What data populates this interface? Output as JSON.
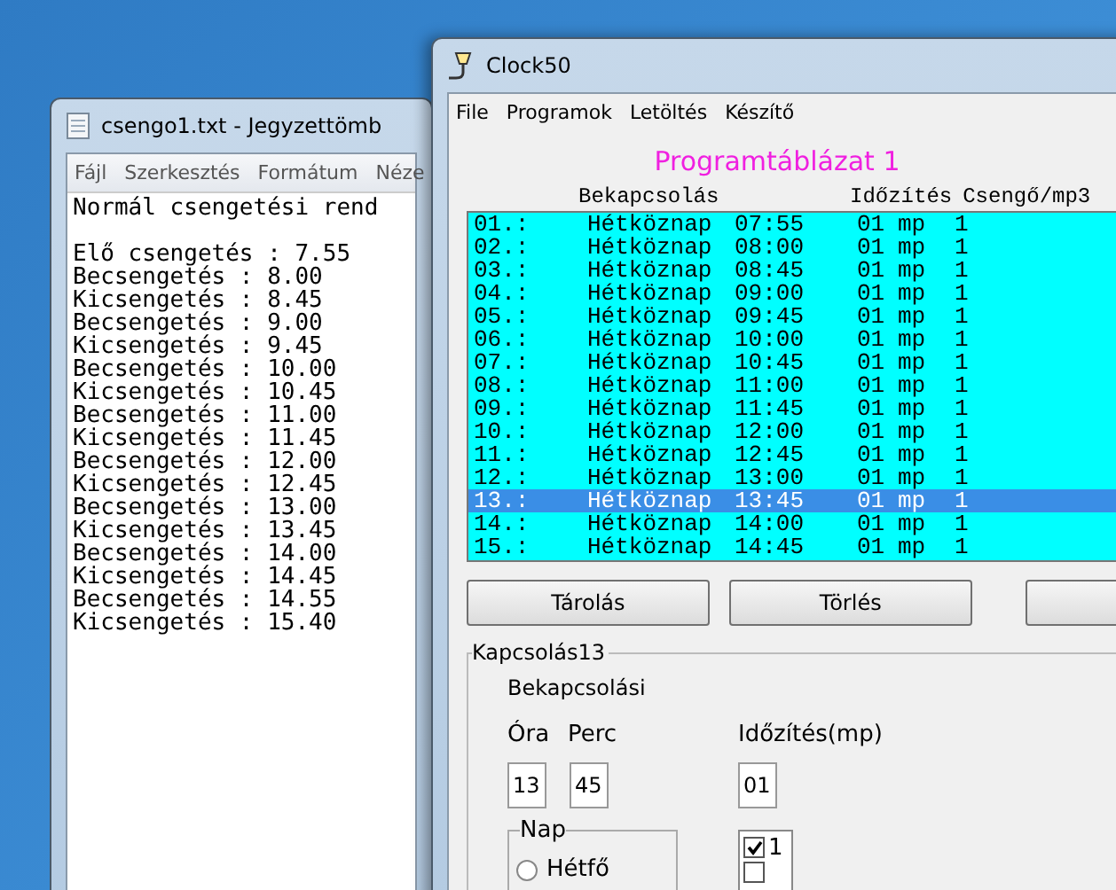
{
  "notepad": {
    "title": "csengo1.txt - Jegyzettömb",
    "menu": [
      "Fájl",
      "Szerkesztés",
      "Formátum",
      "Néze"
    ],
    "heading_line": "Normál csengetési rend",
    "lines": [
      "Elő csengetés : 7.55",
      "Becsengetés : 8.00",
      "Kicsengetés : 8.45",
      "Becsengetés : 9.00",
      "Kicsengetés : 9.45",
      "Becsengetés : 10.00",
      "Kicsengetés : 10.45",
      "Becsengetés : 11.00",
      "Kicsengetés : 11.45",
      "Becsengetés : 12.00",
      "Kicsengetés : 12.45",
      "Becsengetés : 13.00",
      "Kicsengetés : 13.45",
      "Becsengetés : 14.00",
      "Kicsengetés : 14.45",
      "Becsengetés : 14.55",
      "Kicsengetés : 15.40"
    ]
  },
  "clock": {
    "title": "Clock50",
    "menu": [
      "File",
      "Programok",
      "Letöltés",
      "Készítő"
    ],
    "heading": "Programtáblázat 1",
    "columns": [
      "Bekapcsolás",
      "Időzítés",
      "Csengő/mp3"
    ],
    "rows": [
      {
        "number": "01.:",
        "day": "Hétköznap",
        "time": "07:55",
        "timer": "01",
        "unit": "mp",
        "bell": "1",
        "selected": false
      },
      {
        "number": "02.:",
        "day": "Hétköznap",
        "time": "08:00",
        "timer": "01",
        "unit": "mp",
        "bell": "1",
        "selected": false
      },
      {
        "number": "03.:",
        "day": "Hétköznap",
        "time": "08:45",
        "timer": "01",
        "unit": "mp",
        "bell": "1",
        "selected": false
      },
      {
        "number": "04.:",
        "day": "Hétköznap",
        "time": "09:00",
        "timer": "01",
        "unit": "mp",
        "bell": "1",
        "selected": false
      },
      {
        "number": "05.:",
        "day": "Hétköznap",
        "time": "09:45",
        "timer": "01",
        "unit": "mp",
        "bell": "1",
        "selected": false
      },
      {
        "number": "06.:",
        "day": "Hétköznap",
        "time": "10:00",
        "timer": "01",
        "unit": "mp",
        "bell": "1",
        "selected": false
      },
      {
        "number": "07.:",
        "day": "Hétköznap",
        "time": "10:45",
        "timer": "01",
        "unit": "mp",
        "bell": "1",
        "selected": false
      },
      {
        "number": "08.:",
        "day": "Hétköznap",
        "time": "11:00",
        "timer": "01",
        "unit": "mp",
        "bell": "1",
        "selected": false
      },
      {
        "number": "09.:",
        "day": "Hétköznap",
        "time": "11:45",
        "timer": "01",
        "unit": "mp",
        "bell": "1",
        "selected": false
      },
      {
        "number": "10.:",
        "day": "Hétköznap",
        "time": "12:00",
        "timer": "01",
        "unit": "mp",
        "bell": "1",
        "selected": false
      },
      {
        "number": "11.:",
        "day": "Hétköznap",
        "time": "12:45",
        "timer": "01",
        "unit": "mp",
        "bell": "1",
        "selected": false
      },
      {
        "number": "12.:",
        "day": "Hétköznap",
        "time": "13:00",
        "timer": "01",
        "unit": "mp",
        "bell": "1",
        "selected": false
      },
      {
        "number": "13.:",
        "day": "Hétköznap",
        "time": "13:45",
        "timer": "01",
        "unit": "mp",
        "bell": "1",
        "selected": true
      },
      {
        "number": "14.:",
        "day": "Hétköznap",
        "time": "14:00",
        "timer": "01",
        "unit": "mp",
        "bell": "1",
        "selected": false
      },
      {
        "number": "15.:",
        "day": "Hétköznap",
        "time": "14:45",
        "timer": "01",
        "unit": "mp",
        "bell": "1",
        "selected": false
      }
    ],
    "buttons": [
      "Tárolás",
      "Törlés"
    ],
    "group": {
      "title": "Kapcsolás13",
      "subtitle": "Bekapcsolási",
      "hour_label": "Óra",
      "minute_label": "Perc",
      "timer_label": "Időzítés(mp)",
      "hour": "13",
      "minute": "45",
      "timer": "01",
      "day_group": {
        "title": "Nap",
        "options": [
          {
            "label": "Hétfő",
            "selected": false
          }
        ]
      },
      "bells": [
        {
          "label": "1",
          "checked": true
        },
        {
          "checked": false
        }
      ]
    }
  }
}
